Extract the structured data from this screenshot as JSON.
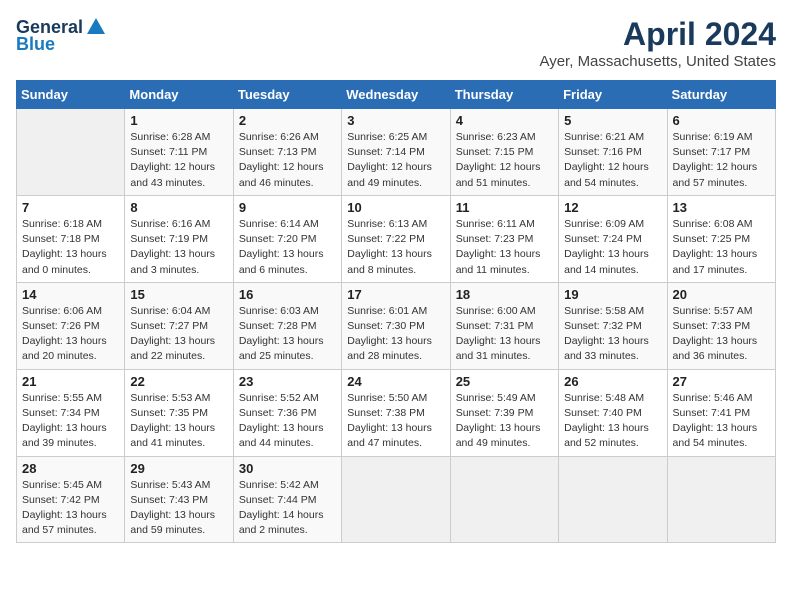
{
  "header": {
    "logo_general": "General",
    "logo_blue": "Blue",
    "title": "April 2024",
    "subtitle": "Ayer, Massachusetts, United States"
  },
  "weekdays": [
    "Sunday",
    "Monday",
    "Tuesday",
    "Wednesday",
    "Thursday",
    "Friday",
    "Saturday"
  ],
  "weeks": [
    [
      {
        "day": "",
        "info": ""
      },
      {
        "day": "1",
        "info": "Sunrise: 6:28 AM\nSunset: 7:11 PM\nDaylight: 12 hours\nand 43 minutes."
      },
      {
        "day": "2",
        "info": "Sunrise: 6:26 AM\nSunset: 7:13 PM\nDaylight: 12 hours\nand 46 minutes."
      },
      {
        "day": "3",
        "info": "Sunrise: 6:25 AM\nSunset: 7:14 PM\nDaylight: 12 hours\nand 49 minutes."
      },
      {
        "day": "4",
        "info": "Sunrise: 6:23 AM\nSunset: 7:15 PM\nDaylight: 12 hours\nand 51 minutes."
      },
      {
        "day": "5",
        "info": "Sunrise: 6:21 AM\nSunset: 7:16 PM\nDaylight: 12 hours\nand 54 minutes."
      },
      {
        "day": "6",
        "info": "Sunrise: 6:19 AM\nSunset: 7:17 PM\nDaylight: 12 hours\nand 57 minutes."
      }
    ],
    [
      {
        "day": "7",
        "info": "Sunrise: 6:18 AM\nSunset: 7:18 PM\nDaylight: 13 hours\nand 0 minutes."
      },
      {
        "day": "8",
        "info": "Sunrise: 6:16 AM\nSunset: 7:19 PM\nDaylight: 13 hours\nand 3 minutes."
      },
      {
        "day": "9",
        "info": "Sunrise: 6:14 AM\nSunset: 7:20 PM\nDaylight: 13 hours\nand 6 minutes."
      },
      {
        "day": "10",
        "info": "Sunrise: 6:13 AM\nSunset: 7:22 PM\nDaylight: 13 hours\nand 8 minutes."
      },
      {
        "day": "11",
        "info": "Sunrise: 6:11 AM\nSunset: 7:23 PM\nDaylight: 13 hours\nand 11 minutes."
      },
      {
        "day": "12",
        "info": "Sunrise: 6:09 AM\nSunset: 7:24 PM\nDaylight: 13 hours\nand 14 minutes."
      },
      {
        "day": "13",
        "info": "Sunrise: 6:08 AM\nSunset: 7:25 PM\nDaylight: 13 hours\nand 17 minutes."
      }
    ],
    [
      {
        "day": "14",
        "info": "Sunrise: 6:06 AM\nSunset: 7:26 PM\nDaylight: 13 hours\nand 20 minutes."
      },
      {
        "day": "15",
        "info": "Sunrise: 6:04 AM\nSunset: 7:27 PM\nDaylight: 13 hours\nand 22 minutes."
      },
      {
        "day": "16",
        "info": "Sunrise: 6:03 AM\nSunset: 7:28 PM\nDaylight: 13 hours\nand 25 minutes."
      },
      {
        "day": "17",
        "info": "Sunrise: 6:01 AM\nSunset: 7:30 PM\nDaylight: 13 hours\nand 28 minutes."
      },
      {
        "day": "18",
        "info": "Sunrise: 6:00 AM\nSunset: 7:31 PM\nDaylight: 13 hours\nand 31 minutes."
      },
      {
        "day": "19",
        "info": "Sunrise: 5:58 AM\nSunset: 7:32 PM\nDaylight: 13 hours\nand 33 minutes."
      },
      {
        "day": "20",
        "info": "Sunrise: 5:57 AM\nSunset: 7:33 PM\nDaylight: 13 hours\nand 36 minutes."
      }
    ],
    [
      {
        "day": "21",
        "info": "Sunrise: 5:55 AM\nSunset: 7:34 PM\nDaylight: 13 hours\nand 39 minutes."
      },
      {
        "day": "22",
        "info": "Sunrise: 5:53 AM\nSunset: 7:35 PM\nDaylight: 13 hours\nand 41 minutes."
      },
      {
        "day": "23",
        "info": "Sunrise: 5:52 AM\nSunset: 7:36 PM\nDaylight: 13 hours\nand 44 minutes."
      },
      {
        "day": "24",
        "info": "Sunrise: 5:50 AM\nSunset: 7:38 PM\nDaylight: 13 hours\nand 47 minutes."
      },
      {
        "day": "25",
        "info": "Sunrise: 5:49 AM\nSunset: 7:39 PM\nDaylight: 13 hours\nand 49 minutes."
      },
      {
        "day": "26",
        "info": "Sunrise: 5:48 AM\nSunset: 7:40 PM\nDaylight: 13 hours\nand 52 minutes."
      },
      {
        "day": "27",
        "info": "Sunrise: 5:46 AM\nSunset: 7:41 PM\nDaylight: 13 hours\nand 54 minutes."
      }
    ],
    [
      {
        "day": "28",
        "info": "Sunrise: 5:45 AM\nSunset: 7:42 PM\nDaylight: 13 hours\nand 57 minutes."
      },
      {
        "day": "29",
        "info": "Sunrise: 5:43 AM\nSunset: 7:43 PM\nDaylight: 13 hours\nand 59 minutes."
      },
      {
        "day": "30",
        "info": "Sunrise: 5:42 AM\nSunset: 7:44 PM\nDaylight: 14 hours\nand 2 minutes."
      },
      {
        "day": "",
        "info": ""
      },
      {
        "day": "",
        "info": ""
      },
      {
        "day": "",
        "info": ""
      },
      {
        "day": "",
        "info": ""
      }
    ]
  ]
}
